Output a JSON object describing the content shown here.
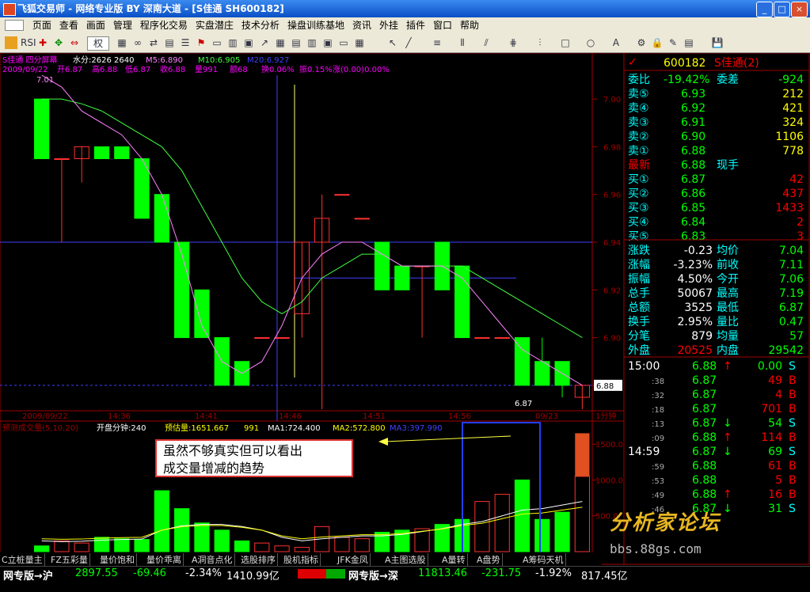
{
  "window": {
    "title": "飞狐交易师 - 网络专业版 BY 深南大道 - [S佳通 SH600182]"
  },
  "menu": [
    "页面",
    "查看",
    "画面",
    "管理",
    "程序化交易",
    "实盘潜庄",
    "技术分析",
    "操盘训练基地",
    "资讯",
    "外挂",
    "插件",
    "窗口",
    "帮助"
  ],
  "toolbar": {
    "weight_label": "权"
  },
  "chart_header": {
    "line1": {
      "name": "S佳通 四分屏幕",
      "shui": "水分:2626  2640",
      "ma5": "M5:6.890",
      "ma10": "M10:6.905",
      "ma20": "M20:6.927"
    },
    "line2": {
      "date": "2009/09/22",
      "open": "开6.87",
      "high": "高6.88",
      "low": "低6.87",
      "close": "收6.88",
      "vol": "量991",
      "amt": "额68",
      "turn": "换0.06%",
      "amp": "振0.15%",
      "chg": "涨(0.00)0.00%"
    },
    "top_label": "7.01",
    "low_label": "6.87"
  },
  "vol_header": {
    "name": "预测成交量(5,10,20)",
    "open_min": "开盘分钟:240",
    "est": "预估量:1651.667",
    "vol": "991",
    "ma1": "MA1:724.400",
    "ma2": "MA2:572.800",
    "ma3": "MA3:397.990"
  },
  "axis": {
    "price_ticks": [
      "7.00",
      "6.98",
      "6.96",
      "6.94",
      "6.92",
      "6.90",
      "6.88"
    ],
    "current_price": "6.88",
    "vol_ticks": [
      "1500.0",
      "1000.0",
      "500.0"
    ],
    "time_labels": [
      "2009/09/22",
      "14:36",
      "14:41",
      "14:46",
      "14:51",
      "14:56",
      "09/23"
    ],
    "period": "1分钟"
  },
  "annotation": {
    "line1": "虽然不够真实但可以看出",
    "line2": "成交量增减的趋势"
  },
  "chart_data": {
    "type": "candlestick",
    "title": "S佳通 1分钟",
    "ylim": [
      6.87,
      7.01
    ],
    "candles": [
      {
        "o": 7.0,
        "c": 6.975,
        "h": 7.0,
        "l": 6.975
      },
      {
        "o": 6.975,
        "c": 6.975,
        "h": 6.975,
        "l": 6.94
      },
      {
        "o": 6.975,
        "c": 6.98,
        "h": 6.98,
        "l": 6.965
      },
      {
        "o": 6.98,
        "c": 6.975,
        "h": 6.98,
        "l": 6.975
      },
      {
        "o": 6.98,
        "c": 6.975,
        "h": 6.98,
        "l": 6.975
      },
      {
        "o": 6.975,
        "c": 6.95,
        "h": 6.975,
        "l": 6.95
      },
      {
        "o": 6.96,
        "c": 6.94,
        "h": 6.96,
        "l": 6.94
      },
      {
        "o": 6.94,
        "c": 6.9,
        "h": 6.94,
        "l": 6.9
      },
      {
        "o": 6.92,
        "c": 6.9,
        "h": 6.92,
        "l": 6.9
      },
      {
        "o": 6.9,
        "c": 6.88,
        "h": 6.9,
        "l": 6.88
      },
      {
        "o": 6.89,
        "c": 6.88,
        "h": 6.89,
        "l": 6.88
      },
      {
        "o": 6.9,
        "c": 6.9,
        "h": 6.9,
        "l": 6.9
      },
      {
        "o": 6.9,
        "c": 6.9,
        "h": 6.9,
        "l": 6.9
      },
      {
        "o": 6.91,
        "c": 6.94,
        "h": 6.94,
        "l": 6.9
      },
      {
        "o": 6.94,
        "c": 6.95,
        "h": 6.96,
        "l": 6.87
      },
      {
        "o": 6.96,
        "c": 6.96,
        "h": 6.96,
        "l": 6.96
      },
      {
        "o": 6.95,
        "c": 6.95,
        "h": 6.95,
        "l": 6.95
      },
      {
        "o": 6.94,
        "c": 6.92,
        "h": 6.94,
        "l": 6.92
      },
      {
        "o": 6.93,
        "c": 6.92,
        "h": 6.93,
        "l": 6.92
      },
      {
        "o": 6.93,
        "c": 6.93,
        "h": 6.93,
        "l": 6.9
      },
      {
        "o": 6.94,
        "c": 6.92,
        "h": 6.94,
        "l": 6.92
      },
      {
        "o": 6.93,
        "c": 6.9,
        "h": 6.93,
        "l": 6.9
      },
      {
        "o": 6.9,
        "c": 6.9,
        "h": 6.9,
        "l": 6.9
      },
      {
        "o": 6.9,
        "c": 6.9,
        "h": 6.9,
        "l": 6.9
      },
      {
        "o": 6.9,
        "c": 6.88,
        "h": 6.9,
        "l": 6.88
      },
      {
        "o": 6.89,
        "c": 6.88,
        "h": 6.9,
        "l": 6.88
      },
      {
        "o": 6.89,
        "c": 6.88,
        "h": 6.89,
        "l": 6.875
      },
      {
        "o": 6.875,
        "c": 6.88,
        "h": 6.88,
        "l": 6.87
      }
    ],
    "volumes": [
      80,
      150,
      120,
      200,
      180,
      170,
      850,
      600,
      400,
      300,
      150,
      120,
      80,
      60,
      350,
      200,
      180,
      270,
      300,
      320,
      380,
      450,
      700,
      800,
      1000,
      450,
      550,
      1050
    ],
    "volume_est": 1651.667
  },
  "quote": {
    "code": "600182",
    "name": "S佳通(2)",
    "weibi_label": "委比",
    "weibi": "-19.42%",
    "weicha_label": "委差",
    "weicha": "-924",
    "asks": [
      {
        "label": "卖⑤",
        "price": "6.93",
        "vol": "212"
      },
      {
        "label": "卖④",
        "price": "6.92",
        "vol": "421"
      },
      {
        "label": "卖③",
        "price": "6.91",
        "vol": "324"
      },
      {
        "label": "卖②",
        "price": "6.90",
        "vol": "1106"
      },
      {
        "label": "卖①",
        "price": "6.88",
        "vol": "778"
      }
    ],
    "latest_label": "最新",
    "latest": "6.88",
    "xianshou_label": "现手",
    "bids": [
      {
        "label": "买①",
        "price": "6.87",
        "vol": "42"
      },
      {
        "label": "买②",
        "price": "6.86",
        "vol": "437"
      },
      {
        "label": "买③",
        "price": "6.85",
        "vol": "1433"
      },
      {
        "label": "买④",
        "price": "6.84",
        "vol": "2"
      },
      {
        "label": "买⑤",
        "price": "6.83",
        "vol": "3"
      }
    ],
    "stats": [
      {
        "l1": "涨跌",
        "v1": "-0.23",
        "l2": "均价",
        "v2": "7.04"
      },
      {
        "l1": "涨幅",
        "v1": "-3.23%",
        "l2": "前收",
        "v2": "7.11"
      },
      {
        "l1": "振幅",
        "v1": "4.50%",
        "l2": "今开",
        "v2": "7.06"
      },
      {
        "l1": "总手",
        "v1": "50067",
        "l2": "最高",
        "v2": "7.19"
      },
      {
        "l1": "总额",
        "v1": "3525",
        "l2": "最低",
        "v2": "6.87"
      },
      {
        "l1": "换手",
        "v1": "2.95%",
        "l2": "量比",
        "v2": "0.47"
      },
      {
        "l1": "分笔",
        "v1": "879",
        "l2": "均量",
        "v2": "57"
      }
    ],
    "waipan_label": "外盘",
    "waipan": "20525",
    "neipan_label": "内盘",
    "neipan": "29542",
    "ticks": [
      {
        "t": "15:00",
        "p": "6.88",
        "a": "↑",
        "v": "0.00",
        "s": "S"
      },
      {
        "t": ":38",
        "p": "6.87",
        "a": "",
        "v": "49",
        "s": "B"
      },
      {
        "t": ":32",
        "p": "6.87",
        "a": "",
        "v": "4",
        "s": "B"
      },
      {
        "t": ":18",
        "p": "6.87",
        "a": "",
        "v": "701",
        "s": "B"
      },
      {
        "t": ":13",
        "p": "6.87",
        "a": "↓",
        "v": "54",
        "s": "S"
      },
      {
        "t": ":09",
        "p": "6.88",
        "a": "↑",
        "v": "114",
        "s": "B"
      },
      {
        "t": "14:59",
        "p": "6.87",
        "a": "↓",
        "v": "69",
        "s": "S"
      },
      {
        "t": ":59",
        "p": "6.88",
        "a": "",
        "v": "61",
        "s": "B"
      },
      {
        "t": ":53",
        "p": "6.88",
        "a": "",
        "v": "5",
        "s": "B"
      },
      {
        "t": ":49",
        "p": "6.88",
        "a": "↑",
        "v": "16",
        "s": "B"
      },
      {
        "t": ":46",
        "p": "6.87",
        "a": "↓",
        "v": "31",
        "s": "S"
      }
    ]
  },
  "bottom_tabs": [
    "C立桩量主",
    "FZ五彩量",
    "量价饱和",
    "量价乖离",
    "A洞音点化",
    "选股排序",
    "股机指标",
    "JFK金凤",
    "A主图选股",
    "A量转",
    "A盘势",
    "A筹码天机"
  ],
  "status": {
    "sh_label": "网专版→沪",
    "sh_idx": "2897.55",
    "sh_chg": "-69.46",
    "sh_pct": "-2.34%",
    "sh_amt": "1410.99亿",
    "sz_label": "网专版→深",
    "sz_idx": "11813.46",
    "sz_chg": "-231.75",
    "sz_pct": "-1.92%",
    "sz_amt": "817.45亿"
  },
  "watermark": {
    "title": "分析家论坛",
    "url": "bbs.88gs.com"
  },
  "colors": {
    "up": "#ff3030",
    "down": "#00ff00",
    "bg": "#000000",
    "axis": "#a00000",
    "ma5": "#ff80ff",
    "ma10": "#40ff40",
    "text": "#ffff00",
    "cyan": "#00ffff"
  }
}
